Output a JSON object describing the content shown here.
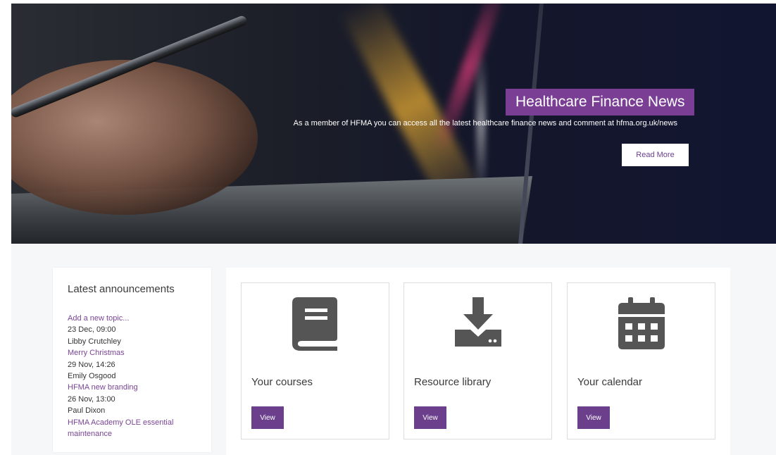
{
  "hero": {
    "title": "Healthcare Finance News",
    "text": "As a member of HFMA you can access all the latest healthcare finance news and comment at hfma.org.uk/news",
    "button_label": "Read More"
  },
  "announcements": {
    "title": "Latest announcements",
    "add_topic": "Add a new topic...",
    "items": [
      {
        "date": "23 Dec, 09:00",
        "author": "Libby Crutchley",
        "subject": "Merry Christmas"
      },
      {
        "date": "29 Nov, 14:26",
        "author": "Emily Osgood",
        "subject": "HFMA new branding"
      },
      {
        "date": "26 Nov, 13:00",
        "author": "Paul Dixon",
        "subject": "HFMA Academy OLE essential maintenance"
      }
    ]
  },
  "tiles": [
    {
      "label": "Your courses",
      "button": "View",
      "icon": "book-icon"
    },
    {
      "label": "Resource library",
      "button": "View",
      "icon": "download-icon"
    },
    {
      "label": "Your calendar",
      "button": "View",
      "icon": "calendar-icon"
    }
  ],
  "colors": {
    "brand_purple": "#6b3f8c",
    "icon_gray": "#555555",
    "hero_dark": "#14172a"
  }
}
